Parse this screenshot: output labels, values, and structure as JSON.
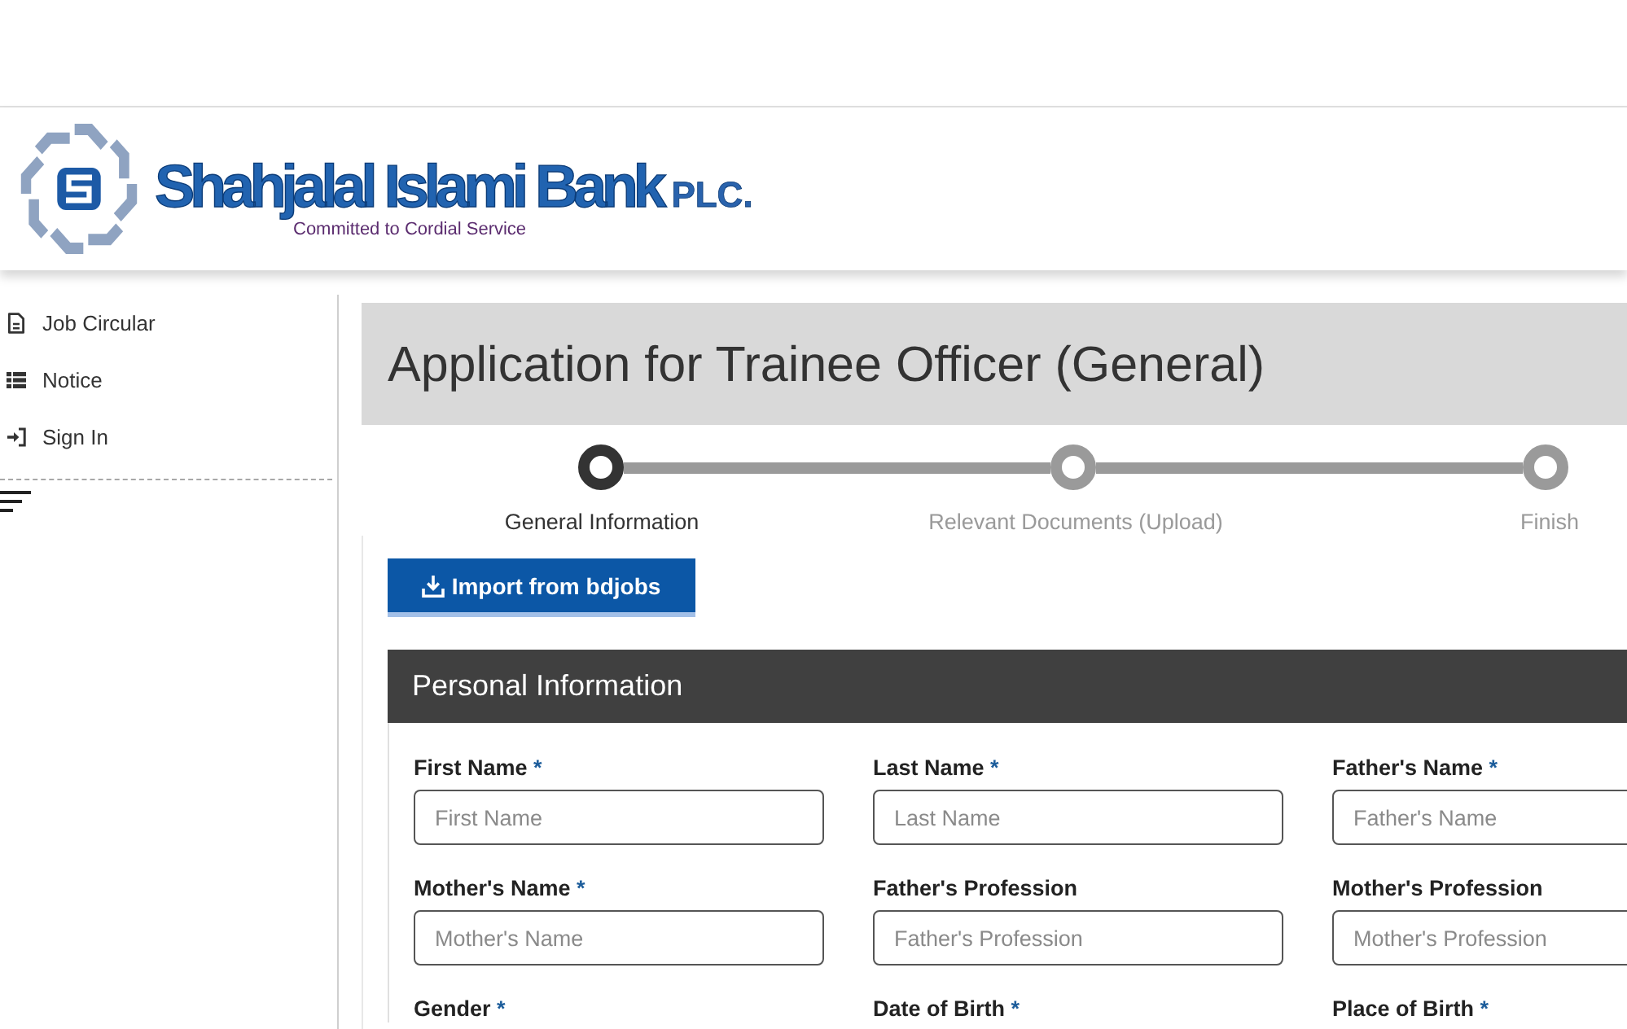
{
  "header": {
    "logo": {
      "name": "Shahjalal Islami Bank",
      "suffix": "PLC.",
      "tagline": "Committed to Cordial Service"
    }
  },
  "sidebar": {
    "items": [
      {
        "label": "Job Circular",
        "kind": "document"
      },
      {
        "label": "Notice",
        "kind": "list"
      },
      {
        "label": "Sign In",
        "kind": "sign-in"
      }
    ]
  },
  "page": {
    "title": "Application for Trainee Officer (General)"
  },
  "steps": [
    {
      "label": "General Information",
      "selected": true
    },
    {
      "label": "Relevant Documents (Upload)",
      "selected": false
    },
    {
      "label": "Finish",
      "selected": false
    }
  ],
  "import_button": {
    "label": "Import from bdjobs"
  },
  "personal_information": {
    "title": "Personal Information",
    "required_mark": "*",
    "fields": [
      {
        "label": "First Name",
        "required": true,
        "placeholder": "First Name"
      },
      {
        "label": "Last Name",
        "required": true,
        "placeholder": "Last Name"
      },
      {
        "label": "Father's Name",
        "required": true,
        "placeholder": "Father's Name"
      },
      {
        "label": "Mother's Name",
        "required": true,
        "placeholder": "Mother's Name"
      },
      {
        "label": "Father's Profession",
        "required": false,
        "placeholder": "Father's Profession"
      },
      {
        "label": "Mother's Profession",
        "required": false,
        "placeholder": "Mother's Profession"
      },
      {
        "label": "Gender",
        "required": true
      },
      {
        "label": "Date of Birth",
        "required": true
      },
      {
        "label": "Place of Birth",
        "required": true
      }
    ]
  }
}
